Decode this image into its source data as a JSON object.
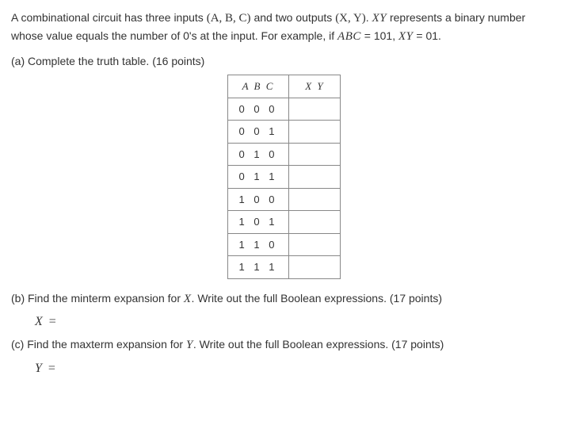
{
  "intro": {
    "part1": "A combinational circuit has three inputs",
    "inputs": "(A, B, C)",
    "part2": "and two outputs",
    "outputs": "(X, Y)",
    "part3": ".",
    "xy1": "XY",
    "part4": "represents a binary number whose value equals the number of 0's at the input. For example, if",
    "abc1": "ABC",
    "part5": "= 101,",
    "xy2": "XY",
    "part6": "= 01."
  },
  "partA": {
    "label": "(a) Complete the truth table. (16 points)"
  },
  "table": {
    "h1": "A B C",
    "h2": "X Y",
    "rows": [
      "0 0 0",
      "0 0 1",
      "0 1 0",
      "0 1 1",
      "1 0 0",
      "1 0 1",
      "1 1 0",
      "1 1 1"
    ]
  },
  "partB": {
    "text1": "(b) Find the minterm expansion for",
    "var": "X",
    "text2": ". Write out the full Boolean expressions. (17 points)",
    "eqvar": "X",
    "eq": "="
  },
  "partC": {
    "text1": "(c) Find the maxterm expansion for",
    "var": "Y",
    "text2": ". Write out the full Boolean expressions. (17 points)",
    "eqvar": "Y",
    "eq": "="
  }
}
